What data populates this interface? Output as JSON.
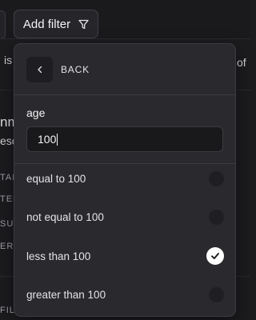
{
  "toolbar": {
    "add_filter_label": "Add filter",
    "filter_icon": "funnel-icon"
  },
  "background": {
    "frag_is": "is",
    "frag_of": "of",
    "frag_title": "nm",
    "frag_desc": "esc",
    "frag_r1": "TAI",
    "frag_r2": "TEM",
    "frag_r3": "SU",
    "frag_r4": "ERI",
    "frag_r5": "FIL"
  },
  "filter_panel": {
    "back_label": "BACK",
    "field_label": "age",
    "input_value": "100",
    "options": [
      {
        "label": "equal to 100",
        "selected": false
      },
      {
        "label": "not equal to 100",
        "selected": false
      },
      {
        "label": "less than 100",
        "selected": true
      },
      {
        "label": "greater than 100",
        "selected": false
      }
    ]
  }
}
